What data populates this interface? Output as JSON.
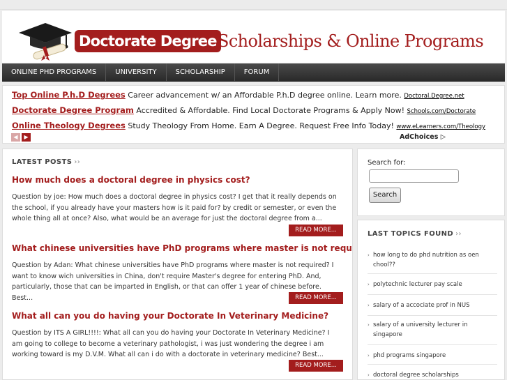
{
  "header": {
    "logo_badge": "Doctorate Degree",
    "logo_rest": "Scholarships & Online Programs"
  },
  "nav": {
    "items": [
      "ONLINE PHD PROGRAMS",
      "UNIVERSITY",
      "SCHOLARSHIP",
      "FORUM"
    ]
  },
  "ads": {
    "rows": [
      {
        "title": "Top Online P.h.D Degrees",
        "text": "Career advancement w/ an Affordable P.h.D degree online. Learn more.",
        "url": "Doctoral.Degree.net"
      },
      {
        "title": "Doctorate Degree Program",
        "text": "Accredited & Affordable. Find Local Doctorate Programs & Apply Now!",
        "url": "Schools.com/Doctorate"
      },
      {
        "title": "Online Theology Degrees",
        "text": "Study Theology From Home. Earn A Degree. Request Free Info Today!",
        "url": "www.eLearners.com/Theology"
      }
    ],
    "prev_icon": "chevron-left-icon",
    "next_icon": "chevron-right-icon",
    "adchoices": "AdChoices"
  },
  "main": {
    "section_title": "LATEST POSTS",
    "chevron": "››",
    "posts": [
      {
        "title": "How much does a doctoral degree in physics cost?",
        "excerpt": "Question by joe: How much does a doctoral degree in physics cost? I get that it really depends on the school, if you already have your masters how is it paid for? by credit or semester, or even the whole thing all at once? Also, what would be an average for just the doctoral degree from a...",
        "read_more": "READ MORE..."
      },
      {
        "title": "What chinese universities have PhD programs where master is not required?",
        "excerpt": "Question by Adan: What chinese universities have PhD programs where master is not required? I want to know wich universities in China, don't require Master's degree for entering PhD. And, particularly, those that can be imparted in English, or that can offer 1 year of chinese before. Best...",
        "read_more": "READ MORE..."
      },
      {
        "title": "What all can you do having your Doctorate In Veterinary Medicine?",
        "excerpt": "Question by ITS A GIRL!!!!: What all can you do having your Doctorate In Veterinary Medicine? I am going to college to become a veterinary pathologist, i was just wondering the degree i am working toward is my D.V.M. What all can i do with a doctorate in veterinary medicine? Best...",
        "read_more": "READ MORE..."
      }
    ]
  },
  "sidebar": {
    "search_label": "Search for:",
    "search_button": "Search",
    "topics_title": "LAST TOPICS FOUND",
    "chevron": "››",
    "topics": [
      "how long to do phd nutrition as oen chool??",
      "polytechnic lecturer pay scale",
      "salary of a accociate prof in NUS",
      "salary of a university lecturer in singapore",
      "phd programs singapore",
      "doctoral degree scholarships"
    ]
  },
  "colors": {
    "brand": "#a31d1d",
    "nav": "#2f2f2f"
  }
}
